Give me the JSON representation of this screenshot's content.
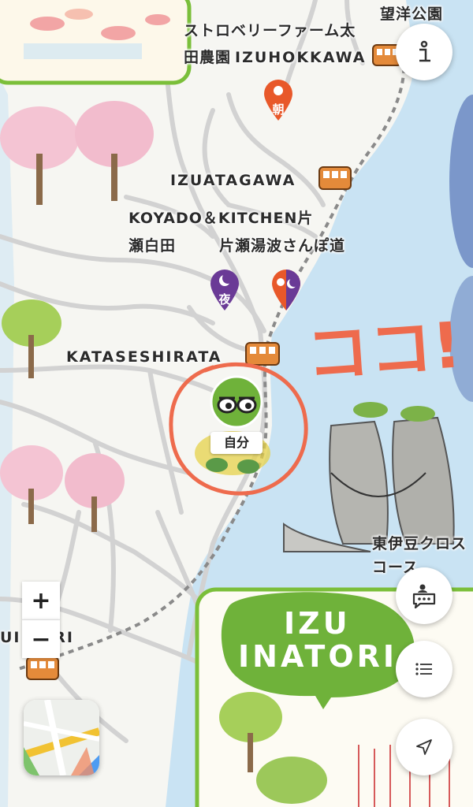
{
  "map": {
    "labels": {
      "boyo_park": "望洋公園",
      "strawberry_1": "ストロベリーファーム太",
      "strawberry_2": "田農園",
      "izuhokkawa": "IZUHOKKAWA",
      "izuatagawa": "IZUATAGAWA",
      "koyado_1": "KOYADO＆KITCHEN片",
      "koyado_2": "瀬白田",
      "katase_walk": "片瀬湯波さんぽ道",
      "kataseshirata": "KATASESHIRATA",
      "cross_course_1": "東伊豆クロス",
      "cross_course_2": "コース",
      "inatori_cut": "UI  TORI"
    },
    "annotation": "ココ!",
    "self_marker_label": "自分",
    "pins": {
      "morning": "朝",
      "night": "夜"
    },
    "area_banner": {
      "line1": "IZU",
      "line2": "INATORI"
    }
  },
  "controls": {
    "zoom_in": "+",
    "zoom_out": "−",
    "info_icon": "info-icon",
    "chat_icon": "chat-bubble-icon",
    "list_icon": "list-icon",
    "locate_icon": "navigation-arrow-icon",
    "map_style_icon": "map-thumbnail-icon"
  },
  "colors": {
    "sea": "#c9e3f3",
    "land": "#f6f6f2",
    "road": "#d2d2d2",
    "railway": "#8a8a8a",
    "green_frame": "#7bbf3a",
    "banner_green": "#6fb23a",
    "pin_morning": "#e8582a",
    "pin_night": "#6a3a96",
    "circle_annotation": "#ee6b4d"
  }
}
